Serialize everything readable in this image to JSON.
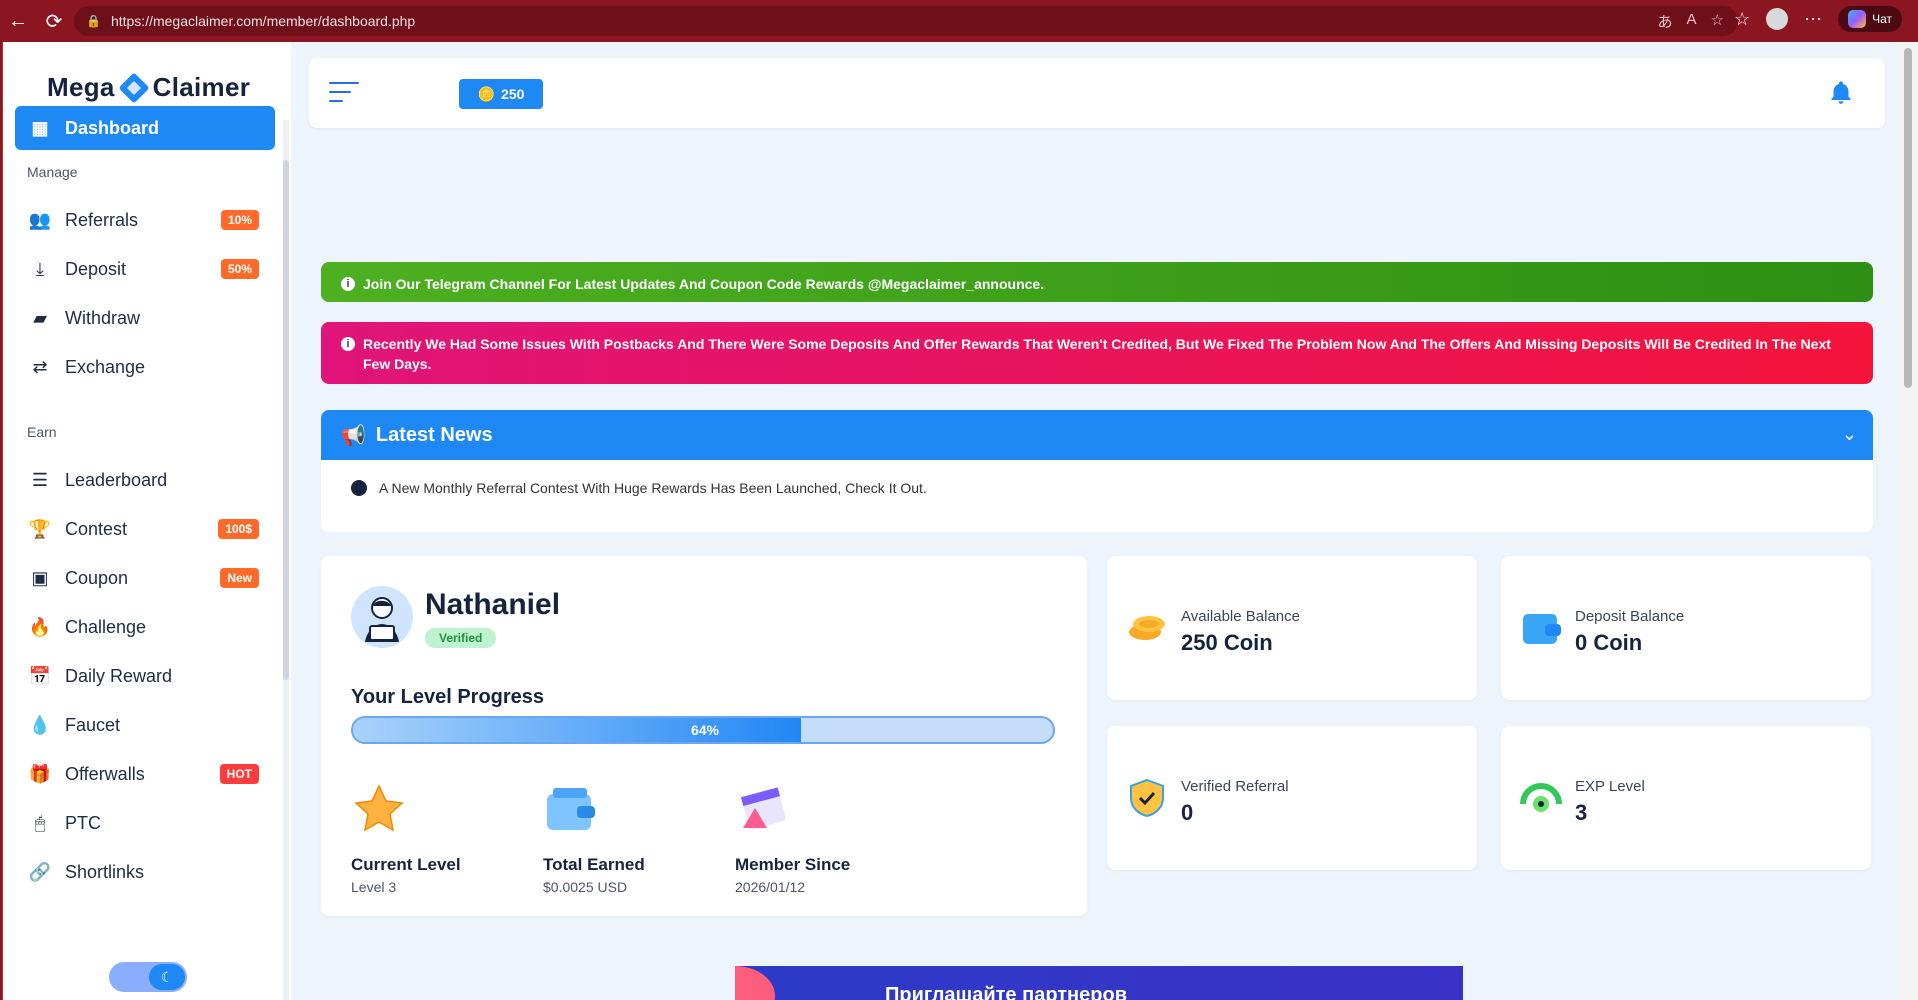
{
  "browser": {
    "url": "https://megaclaimer.com/member/dashboard.php",
    "chat_label": "Чат"
  },
  "brand": {
    "left": "Mega",
    "right": "Claimer"
  },
  "sidebar": {
    "dashboard": "Dashboard",
    "section_manage": "Manage",
    "section_earn": "Earn",
    "items": [
      {
        "label": "Referrals",
        "badge": "10%"
      },
      {
        "label": "Deposit",
        "badge": "50%"
      },
      {
        "label": "Withdraw",
        "badge": ""
      },
      {
        "label": "Exchange",
        "badge": ""
      },
      {
        "label": "Leaderboard",
        "badge": ""
      },
      {
        "label": "Contest",
        "badge": "100$"
      },
      {
        "label": "Coupon",
        "badge": "New"
      },
      {
        "label": "Challenge",
        "badge": ""
      },
      {
        "label": "Daily Reward",
        "badge": ""
      },
      {
        "label": "Faucet",
        "badge": ""
      },
      {
        "label": "Offerwalls",
        "badge": "HOT"
      },
      {
        "label": "PTC",
        "badge": ""
      },
      {
        "label": "Shortlinks",
        "badge": ""
      }
    ]
  },
  "topbar": {
    "coins": "250"
  },
  "alerts": {
    "green": "Join Our Telegram Channel For Latest Updates And Coupon Code Rewards @Megaclaimer_announce.",
    "red": "Recently We Had Some Issues With Postbacks And There Were Some Deposits And Offer Rewards That Weren't Credited, But We Fixed The Problem Now And The Offers And Missing Deposits Will Be Credited In The Next Few Days."
  },
  "news": {
    "title": "Latest News",
    "item": "A New Monthly Referral Contest With Huge Rewards Has Been Launched, Check It Out."
  },
  "profile": {
    "name": "Nathaniel",
    "status": "Verified",
    "level_title": "Your Level Progress",
    "progress_percent": 64,
    "progress_text": "64%",
    "stats": [
      {
        "label": "Current Level",
        "value": "Level 3"
      },
      {
        "label": "Total Earned",
        "value": "$0.0025 USD"
      },
      {
        "label": "Member Since",
        "value": "2026/01/12"
      }
    ]
  },
  "cards": {
    "available_label": "Available Balance",
    "available_value": "250 Coin",
    "deposit_label": "Deposit Balance",
    "deposit_value": "0 Coin",
    "referral_label": "Verified Referral",
    "referral_value": "0",
    "exp_label": "EXP Level",
    "exp_value": "3"
  },
  "ad": {
    "text": "Приглашайте партнеров"
  },
  "colors": {
    "primary": "#1e88f5",
    "green_alert": "#3ea51d",
    "red_alert": "#ea1458",
    "badge_orange": "#ff6a2a",
    "browser_chrome": "#8b1521"
  }
}
